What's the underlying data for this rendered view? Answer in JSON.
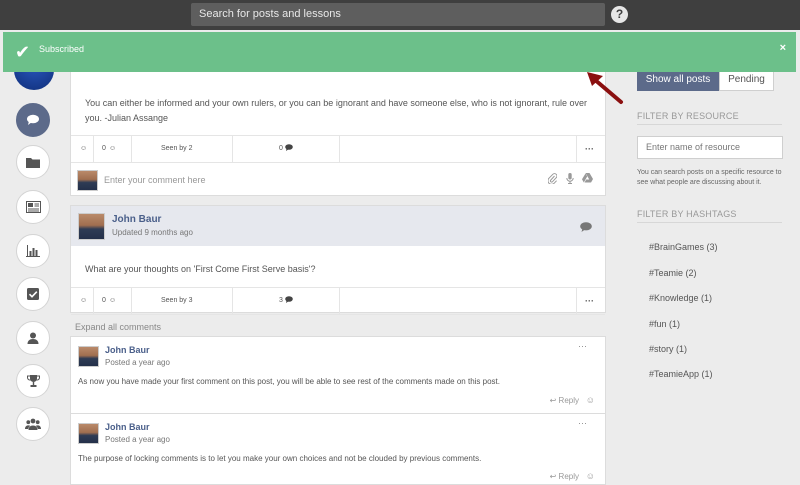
{
  "topbar": {
    "search_placeholder": "Search for posts and lessons",
    "help_label": "?"
  },
  "toast": {
    "message": "Subscribed",
    "close": "×",
    "color": "#6cc08a"
  },
  "posts": [
    {
      "text": "You can either be informed and your own rulers, or you can be ignorant and have someone else, who is not ignorant, rule over you. -Julian Assange",
      "reactions": "0",
      "seen": "Seen by 2",
      "comments": "0",
      "comment_placeholder": "Enter your comment here"
    },
    {
      "author": "John Baur",
      "updated": "Updated 9 months ago",
      "text": "What are your thoughts on 'First Come First Serve basis'?",
      "reactions": "0",
      "seen": "Seen by 3",
      "comments": "3",
      "expand_label": "Expand all comments"
    }
  ],
  "comments": [
    {
      "author": "John Baur",
      "time": "Posted a year ago",
      "text": "As now you have made your first comment on this post, you will be able to see rest of the comments made on this post.",
      "reply": "Reply"
    },
    {
      "author": "John Baur",
      "time": "Posted a year ago",
      "text": "The purpose of locking comments is to let you make your own choices and not be clouded by previous comments.",
      "reply": "Reply"
    }
  ],
  "right_panel": {
    "tabs": [
      "Show all posts",
      "Pending"
    ],
    "filter_resource_title": "FILTER BY RESOURCE",
    "resource_placeholder": "Enter name of resource",
    "resource_help": "You can search posts on a specific resource to see what people are discussing about it.",
    "filter_hashtags_title": "FILTER BY HASHTAGS",
    "hashtags": [
      "#BrainGames (3)",
      "#Teamie (2)",
      "#Knowledge (1)",
      "#fun (1)",
      "#story (1)",
      "#TeamieApp (1)"
    ]
  },
  "colors": {
    "accent": "#5c6a8a",
    "author_link": "#4a5f8a",
    "topbar": "#3f3f3f"
  }
}
